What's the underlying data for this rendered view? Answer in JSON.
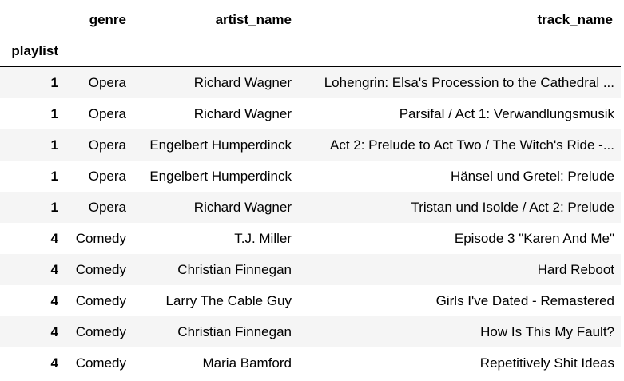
{
  "table": {
    "columns": [
      "genre",
      "artist_name",
      "track_name"
    ],
    "index_name": "playlist",
    "rows": [
      {
        "playlist": "1",
        "genre": "Opera",
        "artist_name": "Richard Wagner",
        "track_name": "Lohengrin: Elsa's Procession to the Cathedral ..."
      },
      {
        "playlist": "1",
        "genre": "Opera",
        "artist_name": "Richard Wagner",
        "track_name": "Parsifal / Act 1: Verwandlungsmusik"
      },
      {
        "playlist": "1",
        "genre": "Opera",
        "artist_name": "Engelbert Humperdinck",
        "track_name": "Act 2: Prelude to Act Two / The Witch's Ride -..."
      },
      {
        "playlist": "1",
        "genre": "Opera",
        "artist_name": "Engelbert Humperdinck",
        "track_name": "Hänsel und Gretel: Prelude"
      },
      {
        "playlist": "1",
        "genre": "Opera",
        "artist_name": "Richard Wagner",
        "track_name": "Tristan und Isolde / Act 2: Prelude"
      },
      {
        "playlist": "4",
        "genre": "Comedy",
        "artist_name": "T.J. Miller",
        "track_name": "Episode 3 \"Karen And Me\""
      },
      {
        "playlist": "4",
        "genre": "Comedy",
        "artist_name": "Christian Finnegan",
        "track_name": "Hard Reboot"
      },
      {
        "playlist": "4",
        "genre": "Comedy",
        "artist_name": "Larry The Cable Guy",
        "track_name": "Girls I've Dated - Remastered"
      },
      {
        "playlist": "4",
        "genre": "Comedy",
        "artist_name": "Christian Finnegan",
        "track_name": "How Is This My Fault?"
      },
      {
        "playlist": "4",
        "genre": "Comedy",
        "artist_name": "Maria Bamford",
        "track_name": "Repetitively Shit Ideas"
      }
    ]
  }
}
